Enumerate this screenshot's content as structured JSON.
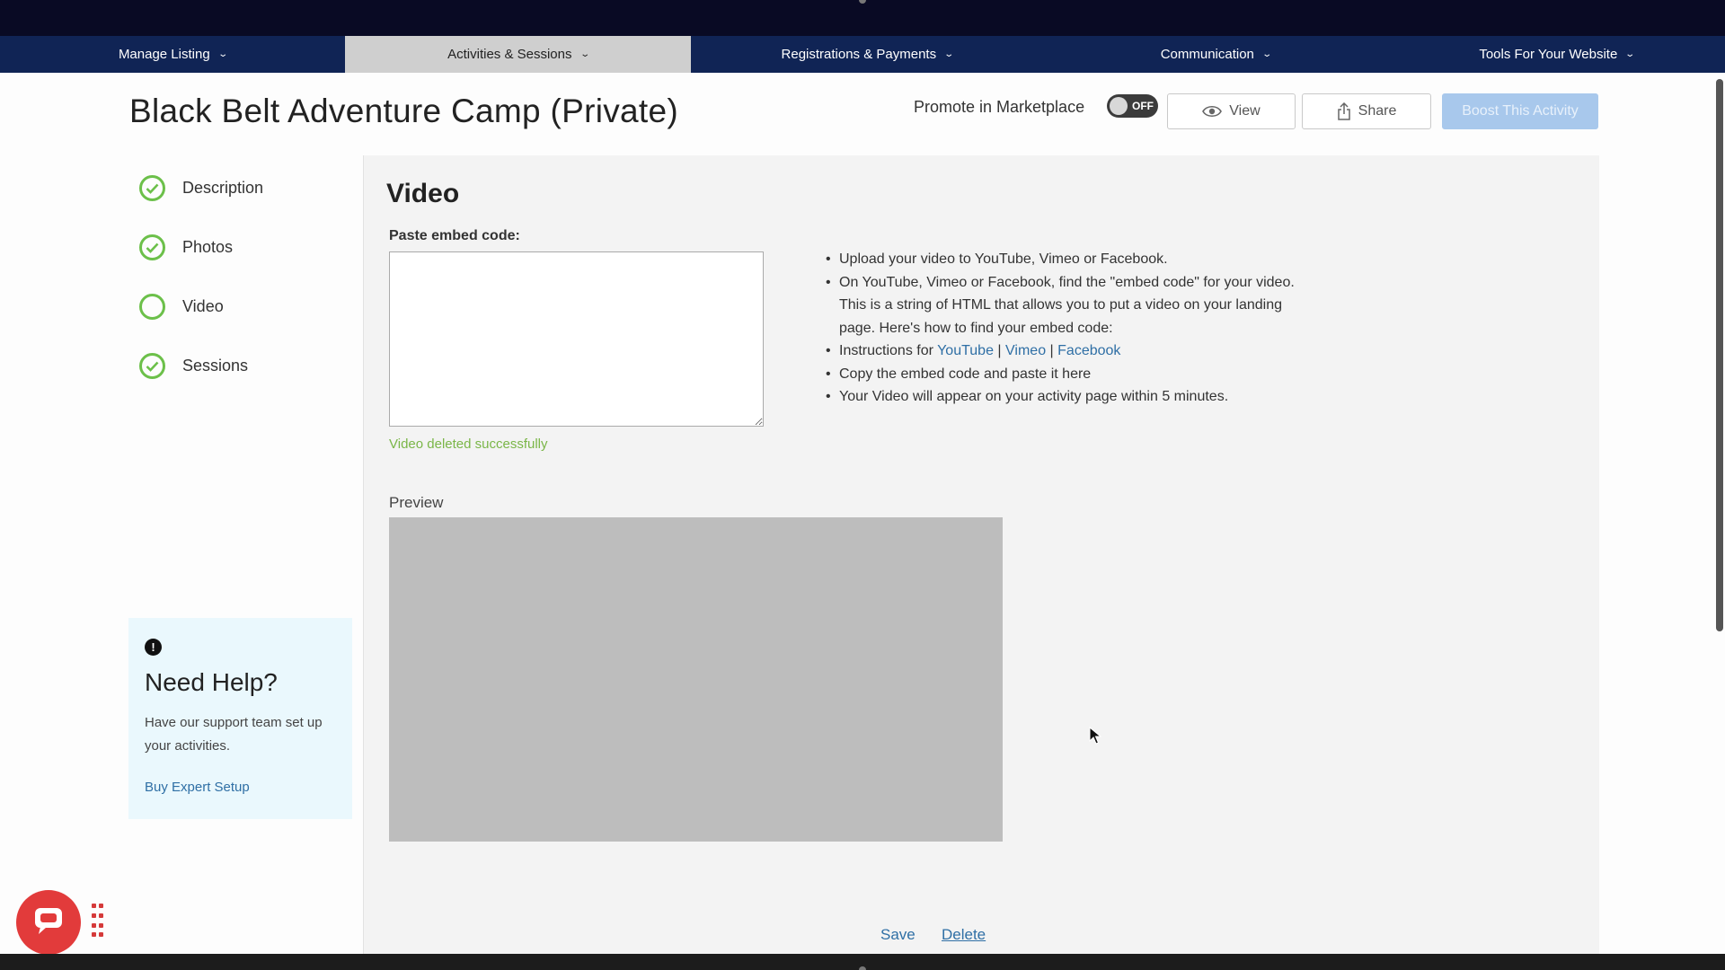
{
  "nav": {
    "items": [
      {
        "label": "Manage Listing",
        "active": false
      },
      {
        "label": "Activities & Sessions",
        "active": true
      },
      {
        "label": "Registrations & Payments",
        "active": false
      },
      {
        "label": "Communication",
        "active": false
      },
      {
        "label": "Tools For Your Website",
        "active": false
      }
    ]
  },
  "header": {
    "title": "Black Belt Adventure Camp (Private)",
    "promote_label": "Promote in Marketplace",
    "promote_toggle": "OFF",
    "view_label": "View",
    "share_label": "Share",
    "boost_label": "Boost This Activity"
  },
  "sidebar": {
    "steps": [
      {
        "label": "Description",
        "status": "complete"
      },
      {
        "label": "Photos",
        "status": "complete"
      },
      {
        "label": "Video",
        "status": "incomplete"
      },
      {
        "label": "Sessions",
        "status": "complete"
      }
    ],
    "help": {
      "title": "Need Help?",
      "text": "Have our support team set up your activities.",
      "link": "Buy Expert Setup"
    }
  },
  "main": {
    "title": "Video",
    "embed_label": "Paste embed code:",
    "embed_value": "",
    "success_message": "Video deleted successfully",
    "instructions": {
      "line1": "Upload your video to YouTube, Vimeo or Facebook.",
      "line2": "On YouTube, Vimeo or Facebook, find the \"embed code\" for your video. This is a string of HTML that allows you to put a video on your landing page. Here's how to find your embed code:",
      "line3_prefix": "Instructions for",
      "link_youtube": "YouTube",
      "link_vimeo": "Vimeo",
      "link_facebook": "Facebook",
      "separator": "|",
      "line4": "Copy the embed code and paste it here",
      "line5": "Your Video will appear on your activity page within 5 minutes."
    },
    "preview_label": "Preview",
    "save_label": "Save",
    "delete_label": "Delete"
  },
  "colors": {
    "nav_bg": "#102455",
    "accent_link": "#2f6fa5",
    "success": "#7ab648",
    "check_green": "#6cc04a",
    "boost_bg": "#a8c8ec",
    "chat_red": "#e23b3b"
  },
  "icons": {
    "nav_dropdown": "chevron-down-icon",
    "view": "eye-icon",
    "share": "share-icon",
    "step_complete": "check-circle-icon",
    "step_incomplete": "empty-circle-icon",
    "help": "exclamation-circle-icon",
    "chat": "chat-bubble-icon",
    "grip": "drag-grip-icon",
    "cursor": "mouse-pointer-icon"
  }
}
